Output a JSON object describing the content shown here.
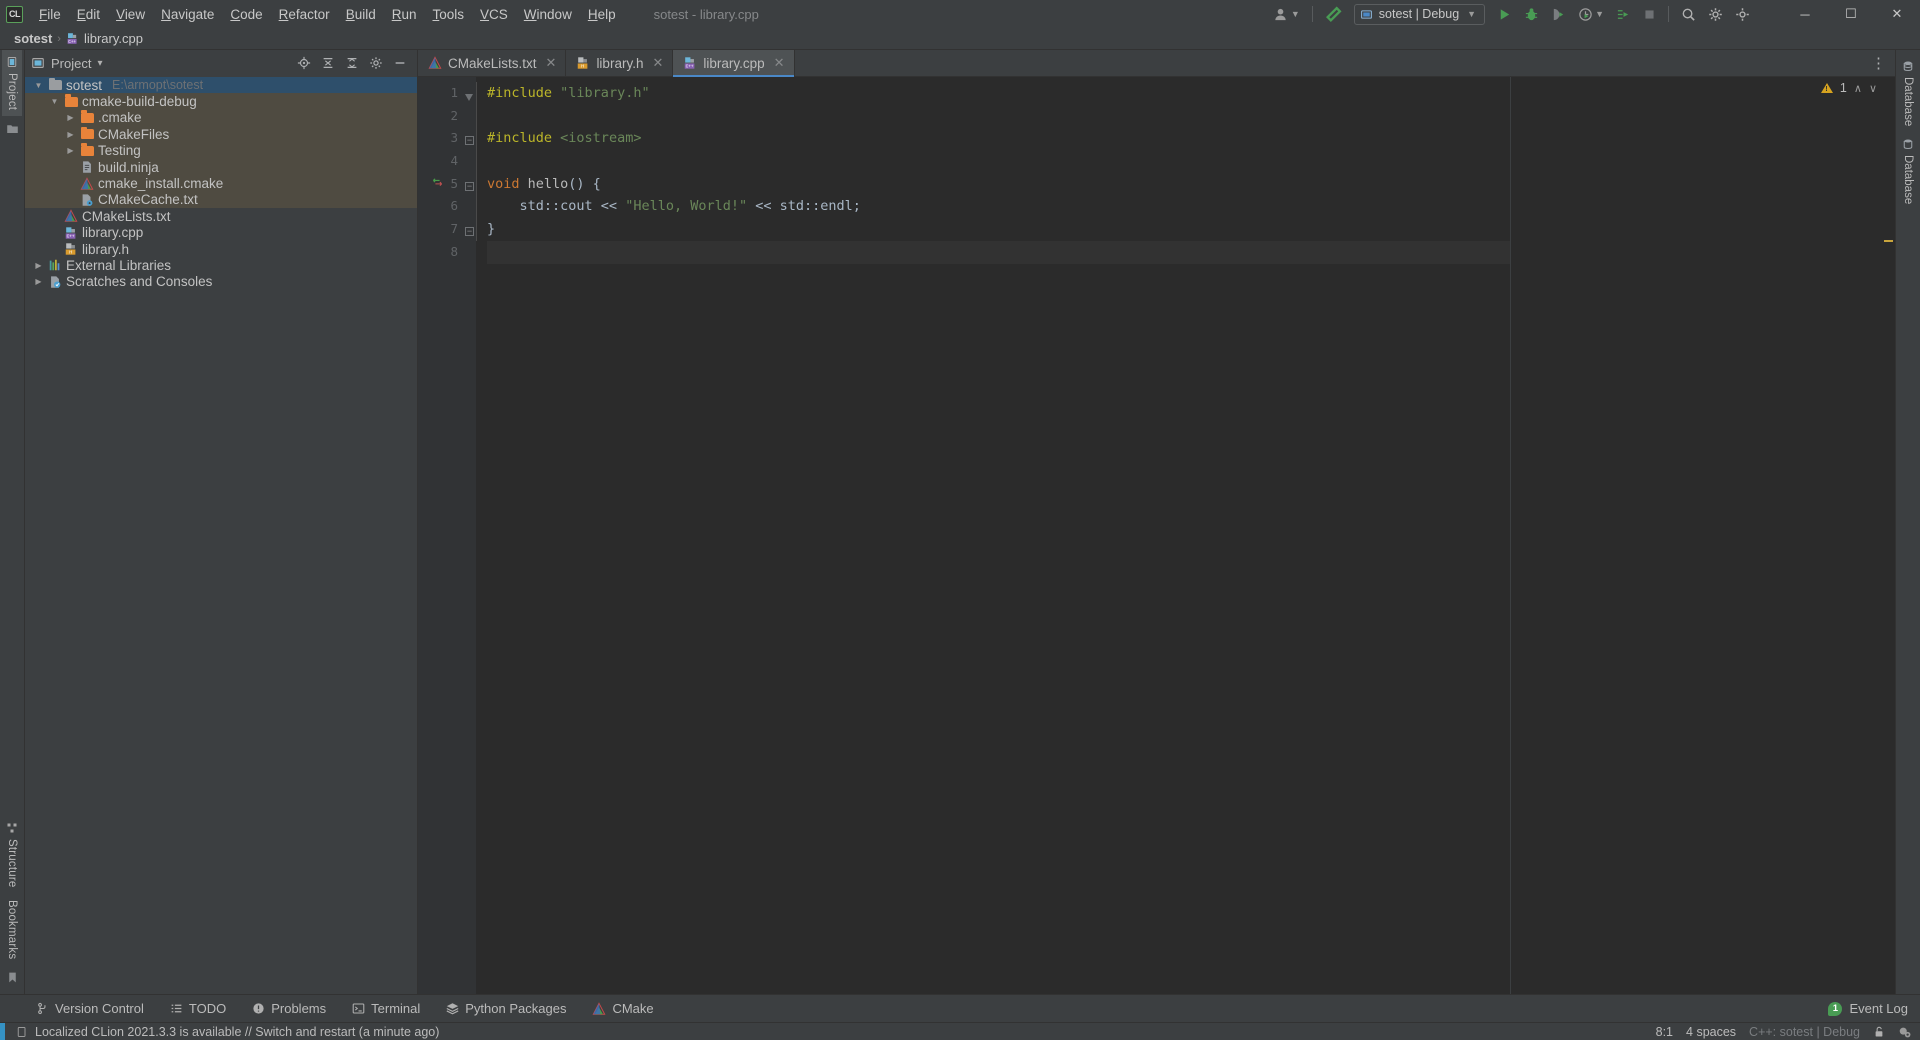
{
  "window": {
    "title": "sotest - library.cpp",
    "app_initials": "CL",
    "minimize": "─",
    "maximize": "☐",
    "close": "✕"
  },
  "menu": {
    "items": [
      {
        "label": "File"
      },
      {
        "label": "Edit"
      },
      {
        "label": "View"
      },
      {
        "label": "Navigate"
      },
      {
        "label": "Code"
      },
      {
        "label": "Refactor"
      },
      {
        "label": "Build"
      },
      {
        "label": "Run"
      },
      {
        "label": "Tools"
      },
      {
        "label": "VCS"
      },
      {
        "label": "Window"
      },
      {
        "label": "Help"
      }
    ]
  },
  "toolbar": {
    "account_icon": "user-icon",
    "build_icon": "hammer-icon",
    "run_config": "sotest | Debug",
    "run_icon": "run-play-icon",
    "debug_icon": "debug-bug-icon",
    "attach_icon": "attach-profile-icon",
    "profile_icon": "profiler-icon",
    "coverage_icon": "run-coverage-icon",
    "stop_icon": "stop-icon",
    "search_icon": "search-icon",
    "settings_icon": "gear-icon",
    "more_icon": "more-gear-icon"
  },
  "navbar": {
    "project": "sotest",
    "file": "library.cpp",
    "separator": "›"
  },
  "left_strip": {
    "project_label": "Project",
    "structure_label": "Structure",
    "bookmarks_label": "Bookmarks"
  },
  "right_strip": {
    "database_label": "Database",
    "database2_label": "Database"
  },
  "panel": {
    "title": "Project",
    "dropdown": "▾",
    "icons": [
      "locate-icon",
      "expand-all-icon",
      "collapse-all-icon",
      "settings-icon",
      "hide-icon"
    ]
  },
  "tree": [
    {
      "label": "sotest",
      "path": "E:\\armopt\\sotest",
      "depth": 0,
      "arrow": "down",
      "icon": "folder-gray",
      "state": "selected"
    },
    {
      "label": "cmake-build-debug",
      "path": "",
      "depth": 1,
      "arrow": "down",
      "icon": "folder-orange",
      "state": "highlight"
    },
    {
      "label": ".cmake",
      "path": "",
      "depth": 2,
      "arrow": "right",
      "icon": "folder-orange",
      "state": "highlight"
    },
    {
      "label": "CMakeFiles",
      "path": "",
      "depth": 2,
      "arrow": "right",
      "icon": "folder-orange",
      "state": "highlight"
    },
    {
      "label": "Testing",
      "path": "",
      "depth": 2,
      "arrow": "right",
      "icon": "folder-orange",
      "state": "highlight"
    },
    {
      "label": "build.ninja",
      "path": "",
      "depth": 2,
      "arrow": "none",
      "icon": "file-text",
      "state": "highlight"
    },
    {
      "label": "cmake_install.cmake",
      "path": "",
      "depth": 2,
      "arrow": "none",
      "icon": "cmake-logo",
      "state": "highlight"
    },
    {
      "label": "CMakeCache.txt",
      "path": "",
      "depth": 2,
      "arrow": "none",
      "icon": "file-gear",
      "state": "highlight"
    },
    {
      "label": "CMakeLists.txt",
      "path": "",
      "depth": 1,
      "arrow": "none",
      "icon": "cmake-logo",
      "state": "normal"
    },
    {
      "label": "library.cpp",
      "path": "",
      "depth": 1,
      "arrow": "none",
      "icon": "cpp-file",
      "state": "normal"
    },
    {
      "label": "library.h",
      "path": "",
      "depth": 1,
      "arrow": "none",
      "icon": "h-file",
      "state": "normal"
    },
    {
      "label": "External Libraries",
      "path": "",
      "depth": 0,
      "arrow": "right",
      "icon": "libraries-icon",
      "state": "normal"
    },
    {
      "label": "Scratches and Consoles",
      "path": "",
      "depth": 0,
      "arrow": "right",
      "icon": "scratches-icon",
      "state": "normal"
    }
  ],
  "tabs": [
    {
      "label": "CMakeLists.txt",
      "icon": "cmake-logo",
      "active": false,
      "close": "✕"
    },
    {
      "label": "library.h",
      "icon": "h-file",
      "active": false,
      "close": "✕"
    },
    {
      "label": "library.cpp",
      "icon": "cpp-file",
      "active": true,
      "close": "✕"
    }
  ],
  "tabbar_right": {
    "more": "⋮"
  },
  "inspections": {
    "count": "1",
    "up": "∧",
    "down": "∨"
  },
  "editor": {
    "line_numbers": [
      "1",
      "2",
      "3",
      "4",
      "5",
      "6",
      "7",
      "8"
    ],
    "current_line": 8,
    "lines": [
      {
        "n": 1,
        "tokens": [
          {
            "t": "#include",
            "c": "pp"
          },
          {
            "t": " ",
            "c": "pl"
          },
          {
            "t": "\"library.h\"",
            "c": "str"
          }
        ]
      },
      {
        "n": 2,
        "tokens": []
      },
      {
        "n": 3,
        "tokens": [
          {
            "t": "#include",
            "c": "pp"
          },
          {
            "t": " ",
            "c": "pl"
          },
          {
            "t": "<iostream>",
            "c": "hdr"
          }
        ]
      },
      {
        "n": 4,
        "tokens": []
      },
      {
        "n": 5,
        "tokens": [
          {
            "t": "void",
            "c": "kw"
          },
          {
            "t": " ",
            "c": "pl"
          },
          {
            "t": "hello",
            "c": "fn"
          },
          {
            "t": "() {",
            "c": "pl"
          }
        ]
      },
      {
        "n": 6,
        "tokens": [
          {
            "t": "    std::cout",
            "c": "pl"
          },
          {
            "t": " << ",
            "c": "pl"
          },
          {
            "t": "\"Hello, World!\"",
            "c": "str"
          },
          {
            "t": " << ",
            "c": "pl"
          },
          {
            "t": "std::endl",
            "c": "pl"
          },
          {
            "t": ";",
            "c": "pl"
          }
        ]
      },
      {
        "n": 7,
        "tokens": [
          {
            "t": "}",
            "c": "pl"
          }
        ]
      },
      {
        "n": 8,
        "tokens": []
      }
    ]
  },
  "toolwindows": [
    {
      "label": "Version Control",
      "icon": "branch-icon"
    },
    {
      "label": "TODO",
      "icon": "list-icon"
    },
    {
      "label": "Problems",
      "icon": "exclamation-circle-icon"
    },
    {
      "label": "Terminal",
      "icon": "terminal-icon"
    },
    {
      "label": "Python Packages",
      "icon": "packages-icon"
    },
    {
      "label": "CMake",
      "icon": "cmake-logo"
    }
  ],
  "event_log": {
    "label": "Event Log",
    "count": "1"
  },
  "status": {
    "message": "Localized CLion 2021.3.3 is available // Switch and restart (a minute ago)",
    "message_icon": "notification-icon",
    "caret": "8:1",
    "indent": "4 spaces",
    "lang_config": "C++: sotest | Debug",
    "lock_icon": "unlock-icon",
    "inspect_icon": "inspection-eye-icon"
  },
  "colors": {
    "accent_blue": "#4a88c7",
    "selection": "#2e4f6b",
    "highlight_brown": "#4f4b41",
    "editor_bg": "#2b2b2b",
    "chrome_bg": "#3c3f41",
    "gutter_bg": "#313335",
    "keyword": "#cc7832",
    "string": "#6a8759",
    "preproc": "#bbb529",
    "warning": "#d6a320",
    "green_run": "#499c54",
    "folder_orange": "#e8833a"
  }
}
